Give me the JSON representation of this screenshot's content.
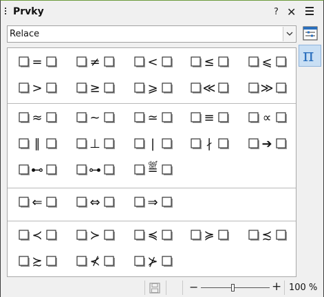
{
  "window": {
    "title": "Prvky",
    "help_label": "?",
    "close_label": "✕"
  },
  "category_select": {
    "selected": "Relace"
  },
  "sidebar": {
    "buttons": [
      {
        "name": "properties-icon"
      },
      {
        "name": "pi-icon",
        "label": "π",
        "active": true
      }
    ]
  },
  "symbol_groups": [
    {
      "items": [
        {
          "op": "="
        },
        {
          "op": "≠"
        },
        {
          "op": "<"
        },
        {
          "op": "≤"
        },
        {
          "op": "⩽"
        },
        {
          "op": ">"
        },
        {
          "op": "≥"
        },
        {
          "op": "⩾"
        },
        {
          "op": "≪"
        },
        {
          "op": "≫"
        }
      ]
    },
    {
      "items": [
        {
          "op": "≈"
        },
        {
          "op": "~"
        },
        {
          "op": "≃"
        },
        {
          "op": "≡"
        },
        {
          "op": "∝"
        },
        {
          "op": "∥"
        },
        {
          "op": "⊥"
        },
        {
          "op": "|"
        },
        {
          "op": "∤"
        },
        {
          "op": "➔"
        },
        {
          "op": "⊷"
        },
        {
          "op": "⊶"
        },
        {
          "op": "≝",
          "sup": "def"
        }
      ]
    },
    {
      "items": [
        {
          "op": "⇐"
        },
        {
          "op": "⇔"
        },
        {
          "op": "⇒"
        }
      ]
    },
    {
      "items": [
        {
          "op": "≺"
        },
        {
          "op": "≻"
        },
        {
          "op": "≼"
        },
        {
          "op": "≽"
        },
        {
          "op": "≾"
        },
        {
          "op": "≿"
        },
        {
          "op": "⊀"
        },
        {
          "op": "⊁"
        }
      ]
    }
  ],
  "statusbar": {
    "zoom_level": "100 %",
    "zoom_fraction": 0.5,
    "minus_label": "−",
    "plus_label": "+"
  }
}
